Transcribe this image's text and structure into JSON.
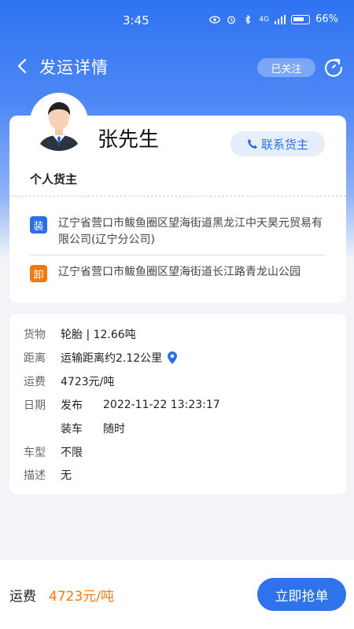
{
  "status_bar": {
    "time": "3:45",
    "network": "4G",
    "battery": "66%"
  },
  "nav": {
    "title": "发运详情",
    "follow_label": "已关注"
  },
  "owner": {
    "name": "张先生",
    "contact_label": "联系货主",
    "type": "个人货主",
    "load_tag": "装",
    "load_address": "辽宁省营口市鲅鱼圈区望海街道黑龙江中天昊元贸易有限公司(辽宁分公司)",
    "unload_tag": "卸",
    "unload_address": "辽宁省营口市鲅鱼圈区望海街道长江路青龙山公园"
  },
  "details": {
    "cargo_label": "货物",
    "cargo_value": "轮胎 | 12.66吨",
    "distance_label": "距离",
    "distance_value": "运输距离约2.12公里",
    "freight_label": "运费",
    "freight_value": "4723元/吨",
    "date_label": "日期",
    "publish_label": "发布",
    "publish_value": "2022-11-22 13:23:17",
    "loading_label": "装车",
    "loading_value": "随时",
    "vehicle_label": "车型",
    "vehicle_value": "不限",
    "desc_label": "描述",
    "desc_value": "无"
  },
  "bottom": {
    "freight_label": "运费",
    "freight_value": "4723元/吨",
    "grab_label": "立即抢单"
  },
  "colors": {
    "primary": "#2e72ec",
    "price": "#ef7a16",
    "load_tag": "#2d6fe6",
    "unload_tag": "#f07a12"
  }
}
